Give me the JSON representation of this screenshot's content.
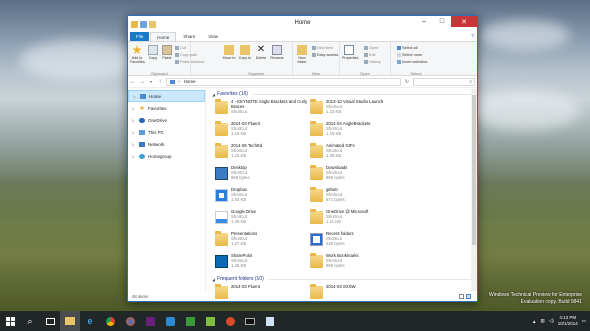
{
  "window": {
    "title": "Home"
  },
  "ribbon_tabs": [
    "File",
    "Home",
    "Share",
    "View"
  ],
  "ribbon": {
    "clipboard": {
      "label": "Clipboard",
      "pin": "Pin to Quick access",
      "copy": "Copy",
      "paste": "Paste",
      "cut": "Cut",
      "copy_path": "Copy path",
      "paste_shortcut": "Paste shortcut",
      "add_favorites": "Add to Favorites"
    },
    "organize": {
      "label": "Organize",
      "move_to": "Move to",
      "copy_to": "Copy to",
      "delete": "Delete",
      "rename": "Rename"
    },
    "new": {
      "label": "New",
      "new_folder": "New folder",
      "new_item": "New item",
      "easy_access": "Easy access"
    },
    "open": {
      "label": "Open",
      "properties": "Properties",
      "open": "Open",
      "edit": "Edit",
      "history": "History"
    },
    "select": {
      "label": "Select",
      "select_all": "Select all",
      "select_none": "Select none",
      "invert": "Invert selection"
    }
  },
  "address": {
    "path": "Home",
    "separator": ">"
  },
  "nav_pane": [
    {
      "label": "Home",
      "selected": true
    },
    {
      "label": "Favorites"
    },
    {
      "label": "OneDrive"
    },
    {
      "label": "This PC"
    },
    {
      "label": "Network"
    },
    {
      "label": "Homegroup"
    }
  ],
  "favorites": {
    "header": "Favorites (16)",
    "items": [
      {
        "name": "4 - KEYNOTE Angle Brackets and Curly Braces",
        "type": "Shortcut",
        "size": "",
        "icon": "folder"
      },
      {
        "name": "2013-10 Visual Studio Launch",
        "type": "Shortcut",
        "size": "1.23 KB",
        "icon": "folder"
      },
      {
        "name": "2014-03 Fluent",
        "type": "Shortcut",
        "size": "1.19 KB",
        "icon": "folder"
      },
      {
        "name": "2014-04 AngleBrackets",
        "type": "Shortcut",
        "size": "1.16 KB",
        "icon": "folder"
      },
      {
        "name": "2014-05 TechEd",
        "type": "Shortcut",
        "size": "1.15 KB",
        "icon": "folder"
      },
      {
        "name": "Animated GIFs",
        "type": "Shortcut",
        "size": "1.38 KB",
        "icon": "folder"
      },
      {
        "name": "Desktop",
        "type": "Shortcut",
        "size": "960 bytes",
        "icon": "desktop"
      },
      {
        "name": "Downloads",
        "type": "Shortcut",
        "size": "969 bytes",
        "icon": "downloads"
      },
      {
        "name": "Dropbox",
        "type": "Shortcut",
        "size": "1.04 KB",
        "icon": "dropbox"
      },
      {
        "name": "github",
        "type": "Shortcut",
        "size": "671 bytes",
        "icon": "folder"
      },
      {
        "name": "Google Drive",
        "type": "Shortcut",
        "size": "1.46 KB",
        "icon": "gdrive"
      },
      {
        "name": "OneDrive @ Microsoft",
        "type": "Shortcut",
        "size": "1.11 KB",
        "icon": "folder"
      },
      {
        "name": "Presentations",
        "type": "Shortcut",
        "size": "1.07 KB",
        "icon": "folder"
      },
      {
        "name": "Recent folders",
        "type": "Shortcut",
        "size": "440 bytes",
        "icon": "recent"
      },
      {
        "name": "SharePoint",
        "type": "Shortcut",
        "size": "1.46 KB",
        "icon": "sharepoint"
      },
      {
        "name": "Work Bookmarks",
        "type": "Shortcut",
        "size": "969 bytes",
        "icon": "folder"
      }
    ]
  },
  "frequent": {
    "header": "Frequent folders (10)",
    "items": [
      {
        "name": "2014-03 Fluent",
        "icon": "folder"
      },
      {
        "name": "2014-03 SXSW",
        "icon": "folder"
      }
    ]
  },
  "status": {
    "count": "48 items"
  },
  "watermark": {
    "line1": "Windows Technical Preview for Enterprise",
    "line2": "Evaluation copy. Build 9841"
  },
  "clock": {
    "time": "4:13 PM",
    "date": "10/1/2014"
  }
}
